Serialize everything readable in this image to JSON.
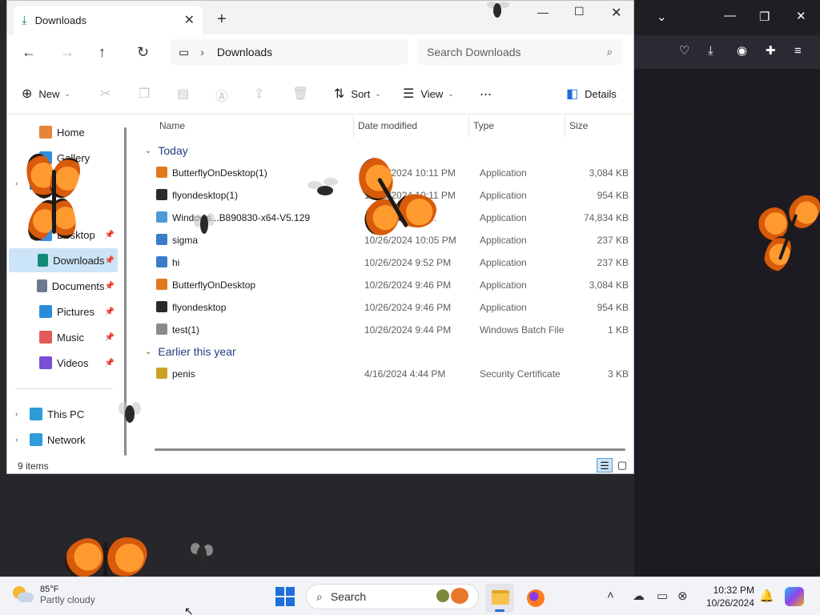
{
  "explorer": {
    "tab_title": "Downloads",
    "address": {
      "location": "Downloads"
    },
    "search": {
      "placeholder": "Search Downloads"
    },
    "commands": {
      "new": "New",
      "sort": "Sort",
      "view": "View",
      "more": "...",
      "details": "Details"
    },
    "nav": {
      "items": [
        {
          "label": "Home",
          "pinned": false,
          "color": "#e8833a"
        },
        {
          "label": "Gallery",
          "pinned": false,
          "color": "#2f8fdd"
        },
        {
          "label": "ive",
          "pinned": false,
          "color": "#1e6fd9"
        },
        {
          "label": "Desktop",
          "pinned": true,
          "color": "#3a8ee6"
        },
        {
          "label": "Downloads",
          "pinned": true,
          "color": "#118a76"
        },
        {
          "label": "Documents",
          "pinned": true,
          "color": "#6b7a8f"
        },
        {
          "label": "Pictures",
          "pinned": true,
          "color": "#2c8bd6"
        },
        {
          "label": "Music",
          "pinned": true,
          "color": "#e25b5b"
        },
        {
          "label": "Videos",
          "pinned": true,
          "color": "#7b4fd6"
        },
        {
          "label": "This PC",
          "pinned": false,
          "color": "#2f9bd8"
        },
        {
          "label": "Network",
          "pinned": false,
          "color": "#2f9bd8"
        }
      ]
    },
    "columns": {
      "name": "Name",
      "date": "Date modified",
      "type": "Type",
      "size": "Size"
    },
    "groups": {
      "today": {
        "label": "Today",
        "files": [
          {
            "name": "ButterflyOnDesktop(1)",
            "date": "10/26/2024 10:11 PM",
            "type": "Application",
            "size": "3,084 KB",
            "icon": "butterfly-icon",
            "color": "#e07a1f"
          },
          {
            "name": "flyondesktop(1)",
            "date": "10/26/2024 10:11 PM",
            "type": "Application",
            "size": "954 KB",
            "icon": "fly-icon",
            "color": "#2a2a2a"
          },
          {
            "name": "Windows...B890830-x64-V5.129",
            "date": "10/26/2024 10:...",
            "type": "Application",
            "size": "74,834 KB",
            "icon": "installer-icon",
            "color": "#4c9ad6"
          },
          {
            "name": "sigma",
            "date": "10/26/2024 10:05 PM",
            "type": "Application",
            "size": "237 KB",
            "icon": "app-icon",
            "color": "#3a7cc7"
          },
          {
            "name": "hi",
            "date": "10/26/2024 9:52 PM",
            "type": "Application",
            "size": "237 KB",
            "icon": "app-icon",
            "color": "#3a7cc7"
          },
          {
            "name": "ButterflyOnDesktop",
            "date": "10/26/2024 9:46 PM",
            "type": "Application",
            "size": "3,084 KB",
            "icon": "butterfly-icon",
            "color": "#e07a1f"
          },
          {
            "name": "flyondesktop",
            "date": "10/26/2024 9:46 PM",
            "type": "Application",
            "size": "954 KB",
            "icon": "fly-icon",
            "color": "#2a2a2a"
          },
          {
            "name": "test(1)",
            "date": "10/26/2024 9:44 PM",
            "type": "Windows Batch File",
            "size": "1 KB",
            "icon": "batch-file-icon",
            "color": "#8a8a8a"
          }
        ]
      },
      "earlier": {
        "label": "Earlier this year",
        "files": [
          {
            "name": "penis",
            "date": "4/16/2024 4:44 PM",
            "type": "Security Certificate",
            "size": "3 KB",
            "icon": "certificate-icon",
            "color": "#c9a227"
          }
        ]
      }
    },
    "status": {
      "count": "9 items"
    }
  },
  "taskbar": {
    "weather": {
      "temp": "85°F",
      "condition": "Partly cloudy"
    },
    "search_label": "Search",
    "clock": {
      "time": "10:32 PM",
      "date": "10/26/2024"
    }
  }
}
